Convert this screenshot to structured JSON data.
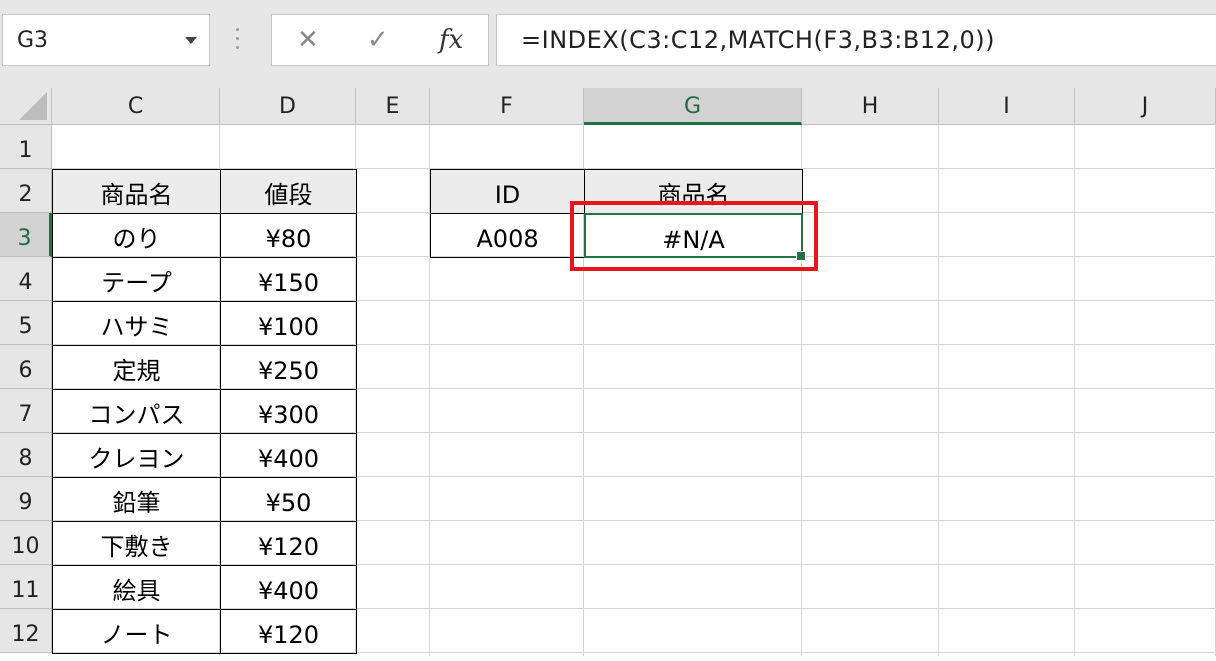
{
  "formula_bar": {
    "name_box": "G3",
    "cancel_icon": "✕",
    "enter_icon": "✓",
    "fx_label": "fx",
    "formula": "=INDEX(C3:C12,MATCH(F3,B3:B12,0))"
  },
  "columns": [
    "C",
    "D",
    "E",
    "F",
    "G",
    "H",
    "I",
    "J"
  ],
  "rows": [
    "1",
    "2",
    "3",
    "4",
    "5",
    "6",
    "7",
    "8",
    "9",
    "10",
    "11",
    "12"
  ],
  "active_cell": {
    "column": "G",
    "row": "3"
  },
  "product_table": {
    "headers": {
      "name": "商品名",
      "price": "値段"
    },
    "rows": [
      {
        "name": "のり",
        "price": "¥80"
      },
      {
        "name": "テープ",
        "price": "¥150"
      },
      {
        "name": "ハサミ",
        "price": "¥100"
      },
      {
        "name": "定規",
        "price": "¥250"
      },
      {
        "name": "コンパス",
        "price": "¥300"
      },
      {
        "name": "クレヨン",
        "price": "¥400"
      },
      {
        "name": "鉛筆",
        "price": "¥50"
      },
      {
        "name": "下敷き",
        "price": "¥120"
      },
      {
        "name": "絵具",
        "price": "¥400"
      },
      {
        "name": "ノート",
        "price": "¥120"
      }
    ]
  },
  "lookup_table": {
    "headers": {
      "id": "ID",
      "name": "商品名"
    },
    "id_value": "A008",
    "result": "#N/A"
  },
  "colors": {
    "selection": "#217346",
    "highlight": "#e8151b"
  }
}
